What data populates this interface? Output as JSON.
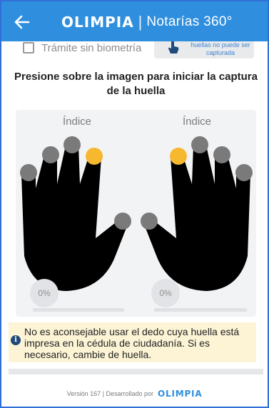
{
  "header": {
    "back_icon": "arrow-left-icon",
    "brand_logo": "OLIMPIA",
    "brand_separator": "|",
    "brand_subtitle": "Notarías 360°",
    "background_color": "#2f8fde"
  },
  "options": {
    "no_biometric_label": "Trámite sin biometría",
    "fingerprint_unavailable_label": "huellas no puede ser capturada",
    "fingerprint_unavailable_icon": "finger-touch-icon"
  },
  "instruction": "Presione sobre la imagen para iniciar la captura de la huella",
  "hands": {
    "left": {
      "label": "Índice",
      "progress": "0%",
      "selected_finger": "index",
      "fill_fraction": 0
    },
    "right": {
      "label": "Índice",
      "progress": "0%",
      "selected_finger": "index",
      "fill_fraction": 0
    },
    "selected_color": "#f5b82e",
    "finger_color": "#7a7a7a",
    "hand_color": "#000000"
  },
  "warning": {
    "icon": "info-icon",
    "text": "No es aconsejable usar el dedo cuya huella está impresa en la cédula de ciudadanía. Si es necesario, cambie de huella."
  },
  "footer": {
    "version_text": "Versión 167 | Desarrollado por",
    "logo": "OLIMPIA"
  }
}
